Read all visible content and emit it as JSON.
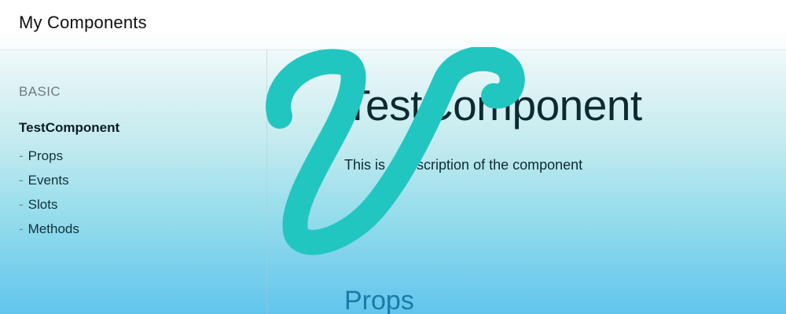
{
  "header": {
    "title": "My Components"
  },
  "sidebar": {
    "section_label": "BASIC",
    "component": "TestComponent",
    "dash": "-",
    "items": [
      {
        "label": "Props"
      },
      {
        "label": "Events"
      },
      {
        "label": "Slots"
      },
      {
        "label": "Methods"
      }
    ]
  },
  "main": {
    "title": "TestComponent",
    "description": "This is a description of the component",
    "props_heading": "Props"
  },
  "colors": {
    "logo": "#22c6c0",
    "heading_accent": "#1b7aa8"
  }
}
